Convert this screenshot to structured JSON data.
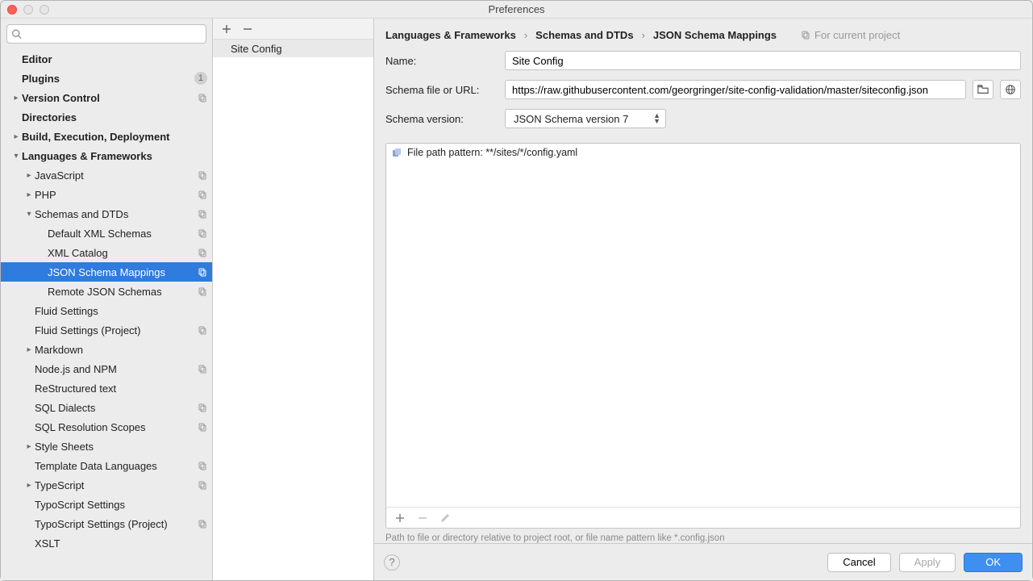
{
  "window": {
    "title": "Preferences"
  },
  "search": {
    "placeholder": ""
  },
  "sidebar": {
    "items": [
      {
        "label": "Editor",
        "indent": 0,
        "bold": true,
        "chev": ""
      },
      {
        "label": "Plugins",
        "indent": 0,
        "bold": true,
        "chev": "",
        "badge": "1"
      },
      {
        "label": "Version Control",
        "indent": 0,
        "bold": true,
        "chev": "right",
        "duplicate": true
      },
      {
        "label": "Directories",
        "indent": 0,
        "bold": true,
        "chev": ""
      },
      {
        "label": "Build, Execution, Deployment",
        "indent": 0,
        "bold": true,
        "chev": "right"
      },
      {
        "label": "Languages & Frameworks",
        "indent": 0,
        "bold": true,
        "chev": "down"
      },
      {
        "label": "JavaScript",
        "indent": 1,
        "chev": "right",
        "duplicate": true
      },
      {
        "label": "PHP",
        "indent": 1,
        "chev": "right",
        "duplicate": true
      },
      {
        "label": "Schemas and DTDs",
        "indent": 1,
        "chev": "down",
        "duplicate": true
      },
      {
        "label": "Default XML Schemas",
        "indent": 2,
        "duplicate": true
      },
      {
        "label": "XML Catalog",
        "indent": 2,
        "duplicate": true
      },
      {
        "label": "JSON Schema Mappings",
        "indent": 2,
        "selected": true,
        "duplicate": true
      },
      {
        "label": "Remote JSON Schemas",
        "indent": 2,
        "duplicate": true
      },
      {
        "label": "Fluid Settings",
        "indent": 1
      },
      {
        "label": "Fluid Settings (Project)",
        "indent": 1,
        "duplicate": true
      },
      {
        "label": "Markdown",
        "indent": 1,
        "chev": "right"
      },
      {
        "label": "Node.js and NPM",
        "indent": 1,
        "duplicate": true
      },
      {
        "label": "ReStructured text",
        "indent": 1
      },
      {
        "label": "SQL Dialects",
        "indent": 1,
        "duplicate": true
      },
      {
        "label": "SQL Resolution Scopes",
        "indent": 1,
        "duplicate": true
      },
      {
        "label": "Style Sheets",
        "indent": 1,
        "chev": "right"
      },
      {
        "label": "Template Data Languages",
        "indent": 1,
        "duplicate": true
      },
      {
        "label": "TypeScript",
        "indent": 1,
        "chev": "right",
        "duplicate": true
      },
      {
        "label": "TypoScript Settings",
        "indent": 1
      },
      {
        "label": "TypoScript Settings (Project)",
        "indent": 1,
        "duplicate": true
      },
      {
        "label": "XSLT",
        "indent": 1
      }
    ]
  },
  "mid": {
    "items": [
      "Site Config"
    ]
  },
  "breadcrumb": {
    "items": [
      "Languages & Frameworks",
      "Schemas and DTDs",
      "JSON Schema Mappings"
    ],
    "scope": "For current project"
  },
  "form": {
    "name_label": "Name:",
    "name_value": "Site Config",
    "url_label": "Schema file or URL:",
    "url_value": "https://raw.githubusercontent.com/georgringer/site-config-validation/master/siteconfig.json",
    "version_label": "Schema version:",
    "version_value": "JSON Schema version 7"
  },
  "patterns": {
    "items": [
      {
        "label": "File path pattern: **/sites/*/config.yaml"
      }
    ]
  },
  "hint": "Path to file or directory relative to project root, or file name pattern like *.config.json",
  "buttons": {
    "cancel": "Cancel",
    "apply": "Apply",
    "ok": "OK"
  }
}
